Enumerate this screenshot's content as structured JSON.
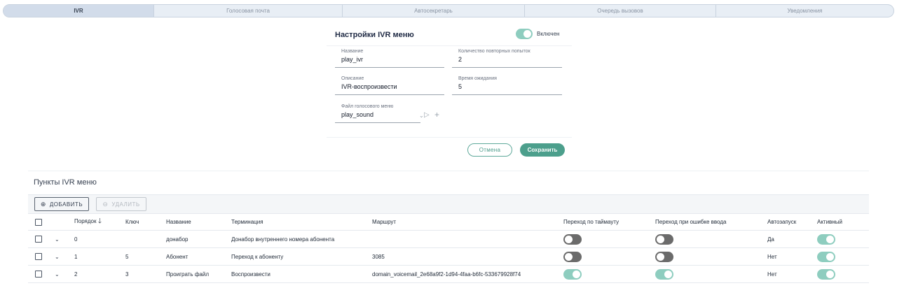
{
  "tabs": [
    "IVR",
    "Голосовая почта",
    "Автосекретарь",
    "Очередь вызовов",
    "Уведомления"
  ],
  "form": {
    "title": "Настройки IVR меню",
    "enabled_label": "Включен",
    "enabled": true,
    "fields": {
      "name": {
        "label": "Название",
        "value": "play_ivr"
      },
      "retries": {
        "label": "Количество повторных попыток",
        "value": "2"
      },
      "description": {
        "label": "Описание",
        "value": "IVR-воспроизвести"
      },
      "timeout": {
        "label": "Время ожидания",
        "value": "5"
      },
      "sound_file": {
        "label": "Файл голосового меню",
        "value": "play_sound"
      }
    },
    "icons": {
      "dropdown": "chevron-down-icon",
      "play": "play-icon",
      "add": "plus-icon"
    },
    "cancel_label": "Отмена",
    "save_label": "Сохранить"
  },
  "items": {
    "title": "Пункты IVR меню",
    "add_label": "ДОБАВИТЬ",
    "delete_label": "УДАЛИТЬ",
    "columns": {
      "order": "Порядок",
      "key": "Ключ",
      "name": "Название",
      "termination": "Терминация",
      "route": "Маршрут",
      "timeout_transition": "Переход по таймауту",
      "error_transition": "Переход при ошибке ввода",
      "autostart": "Автозапуск",
      "active": "Активный"
    },
    "sort_icon": "arrow-down-icon",
    "rows": [
      {
        "order": "0",
        "key": "",
        "name": "донабор",
        "termination": "Донабор внутреннего номера абонента",
        "route": "",
        "timeout_transition": false,
        "error_transition": false,
        "autostart": "Да",
        "active": true
      },
      {
        "order": "1",
        "key": "5",
        "name": "Абонент",
        "termination": "Переход к абоненту",
        "route": "3085",
        "timeout_transition": false,
        "error_transition": false,
        "autostart": "Нет",
        "active": true
      },
      {
        "order": "2",
        "key": "3",
        "name": "Проиграть файл",
        "termination": "Воспроизвести",
        "route": "domain_voicemail_2e68a9f2-1d94-4faa-b6fc-533679928f74",
        "timeout_transition": true,
        "error_transition": true,
        "autostart": "Нет",
        "active": true
      }
    ]
  },
  "colors": {
    "accent": "#4c9f8c",
    "toggle_on": "#8ecdbf",
    "toggle_off": "#6b6b6b",
    "tab_bg": "#e8eef5",
    "tab_active": "#d2dcea"
  }
}
